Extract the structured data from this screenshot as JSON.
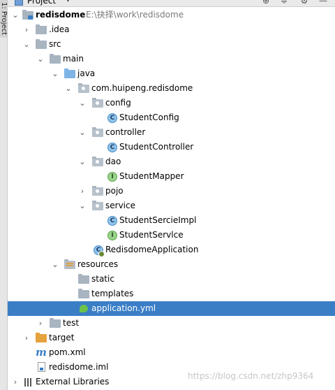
{
  "sidebar": {
    "tab_label": "1: Project"
  },
  "toolbar": {
    "title": "Project",
    "caret": "▾",
    "buttons": [
      {
        "name": "locate",
        "glyph": "⊕"
      },
      {
        "name": "collapse",
        "glyph": "≑"
      },
      {
        "name": "settings",
        "glyph": "⚙"
      },
      {
        "name": "hide",
        "glyph": "—"
      }
    ]
  },
  "tree": {
    "root": {
      "label": "redisdome",
      "path": "E:\\抉择\\work\\redisdome"
    },
    "idea": "idea",
    "src": "src",
    "main": "main",
    "java": "java",
    "package": "com.huipeng.redisdome",
    "config": "config",
    "student_config": "StudentConfig",
    "controller": "controller",
    "student_controller": "StudentController",
    "dao": "dao",
    "student_mapper": "StudentMapper",
    "pojo": "pojo",
    "service": "service",
    "student_service_impl": "StudentSercieImpl",
    "student_service": "StudentServlce",
    "app_class": "RedisdomeApplication",
    "resources": "resources",
    "static": "static",
    "templates": "templates",
    "application_yml": "application.yml",
    "test": "test",
    "target": "target",
    "pom": "pom.xml",
    "iml": "redisdome.iml",
    "external_libraries": "External Libraries"
  },
  "icon_letters": {
    "class": "C",
    "interface": "I",
    "maven": "m"
  },
  "colors": {
    "selection": "#3a7ec6",
    "source_folder": "#7fb4e6",
    "excluded_folder": "#e6a23c"
  },
  "watermark": "https://blog.csdn.net/zhp9364"
}
